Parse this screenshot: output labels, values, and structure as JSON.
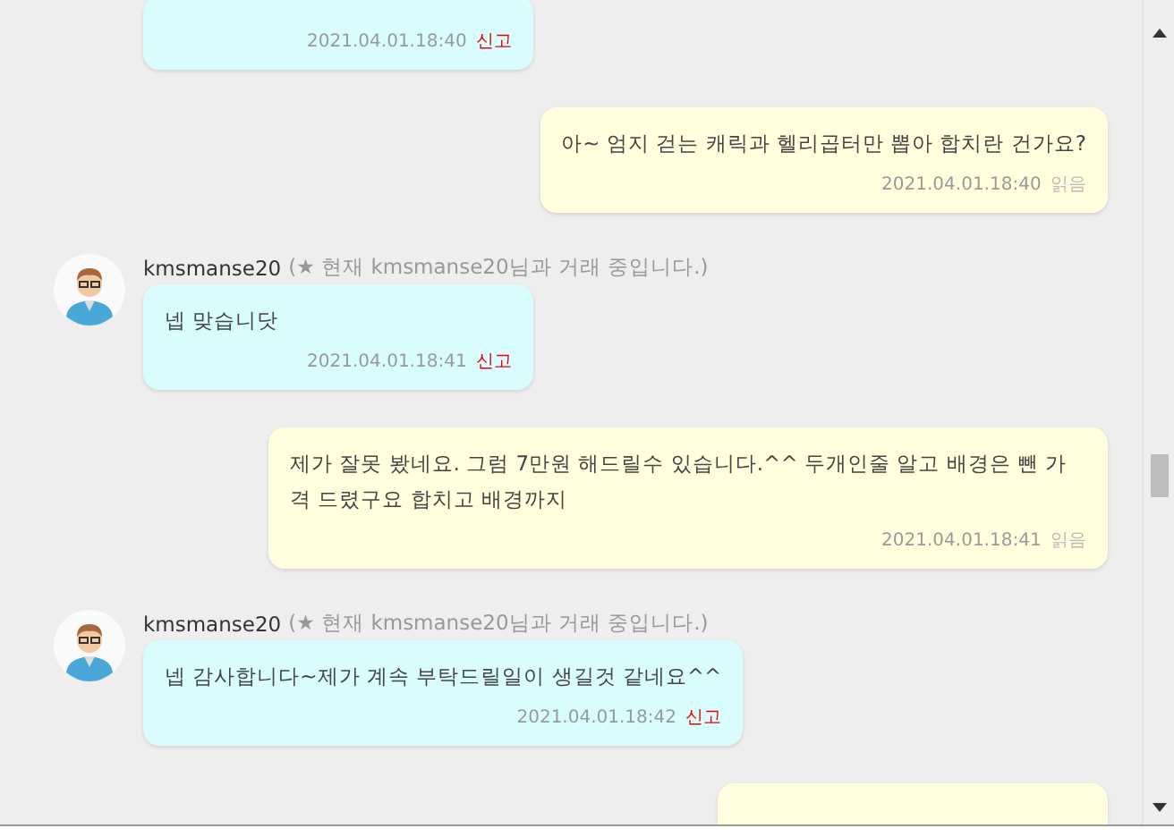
{
  "messages": [
    {
      "kind": "received",
      "time": "2021.04.01.18:40",
      "status": "신고"
    },
    {
      "kind": "sent",
      "text": "아~ 엄지 걷는 캐릭과 헬리곱터만 뽑아 합치란 건가요?",
      "time": "2021.04.01.18:40",
      "status": "읽음"
    },
    {
      "kind": "received",
      "sender": "kmsmanse20",
      "notice": "(★ 현재 kmsmanse20님과 거래 중입니다.)",
      "text": "넵 맞습니닷",
      "time": "2021.04.01.18:41",
      "status": "신고"
    },
    {
      "kind": "sent",
      "text": "제가 잘못 봤네요. 그럼 7만원 해드릴수 있습니다.^^ 두개인줄 알고 배경은 뺀 가격 드렸구요 합치고 배경까지",
      "time": "2021.04.01.18:41",
      "status": "읽음"
    },
    {
      "kind": "received",
      "sender": "kmsmanse20",
      "notice": "(★ 현재 kmsmanse20님과 거래 중입니다.)",
      "text": "넵 감사합니다~제가 계속 부탁드릴일이 생길것 같네요^^",
      "time": "2021.04.01.18:42",
      "status": "신고"
    },
    {
      "kind": "sent"
    }
  ]
}
